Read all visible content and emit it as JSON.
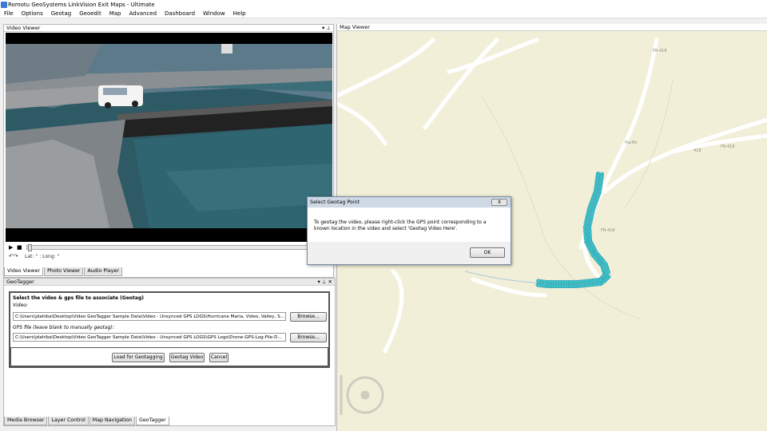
{
  "window": {
    "title": "Romotu GeoSystems LinkVision Exit Maps - Ultimate"
  },
  "menu": [
    "File",
    "Options",
    "Geotag",
    "Geoedit",
    "Map",
    "Advanced",
    "Dashboard",
    "Window",
    "Help"
  ],
  "video_viewer": {
    "title": "Video Viewer",
    "pin": "▾ ⊥",
    "latlong": "Lat: ° : Long: °",
    "tabs": [
      "Video Viewer",
      "Photo Viewer",
      "Audio Player"
    ]
  },
  "geotagger": {
    "title": "GeoTagger",
    "header_buttons": "▾ ⊥ ✕",
    "heading": "Select the video & gps file to associate (Geotag)",
    "video_label": "Video:",
    "video_path": "C:\\Users\\jdahiba\\Desktop\\Video GeoTagger Sample Data\\Video - Unsynced GPS LOGS\\Hurricane Maria, Video, Valley, S...",
    "gps_label": "GPS file (leave blank to manually geotag):",
    "gps_path": "C:\\Users\\jdahiba\\Desktop\\Video GeoTagger Sample Data\\Video - Unsynced GPS LOGS\\GPS Logs\\Drone-GPS-Log-File-D...",
    "browse": "Browse...",
    "btn_load": "Load for Geotagging",
    "btn_geotag": "Geotag Video",
    "btn_cancel": "Cancel",
    "bottom_tabs": [
      "Media Browser",
      "Layer Control",
      "Map Navigation",
      "GeoTagger"
    ]
  },
  "map_viewer": {
    "title": "Map Viewer",
    "road_labels": [
      "FR-418",
      "FR-418",
      "FR-418",
      "Pacific",
      "418"
    ]
  },
  "dialog": {
    "title": "Select Geotag Point",
    "close": "X",
    "message": "To geotag the video, please right-click the GPS point corresponding to a known location in the video and select 'Geotag Video Here'.",
    "ok": "OK"
  },
  "colors": {
    "map_bg": "#f2efd9",
    "gps_points": "#3fc4d0",
    "dialog_title": "#cfd9e6"
  }
}
